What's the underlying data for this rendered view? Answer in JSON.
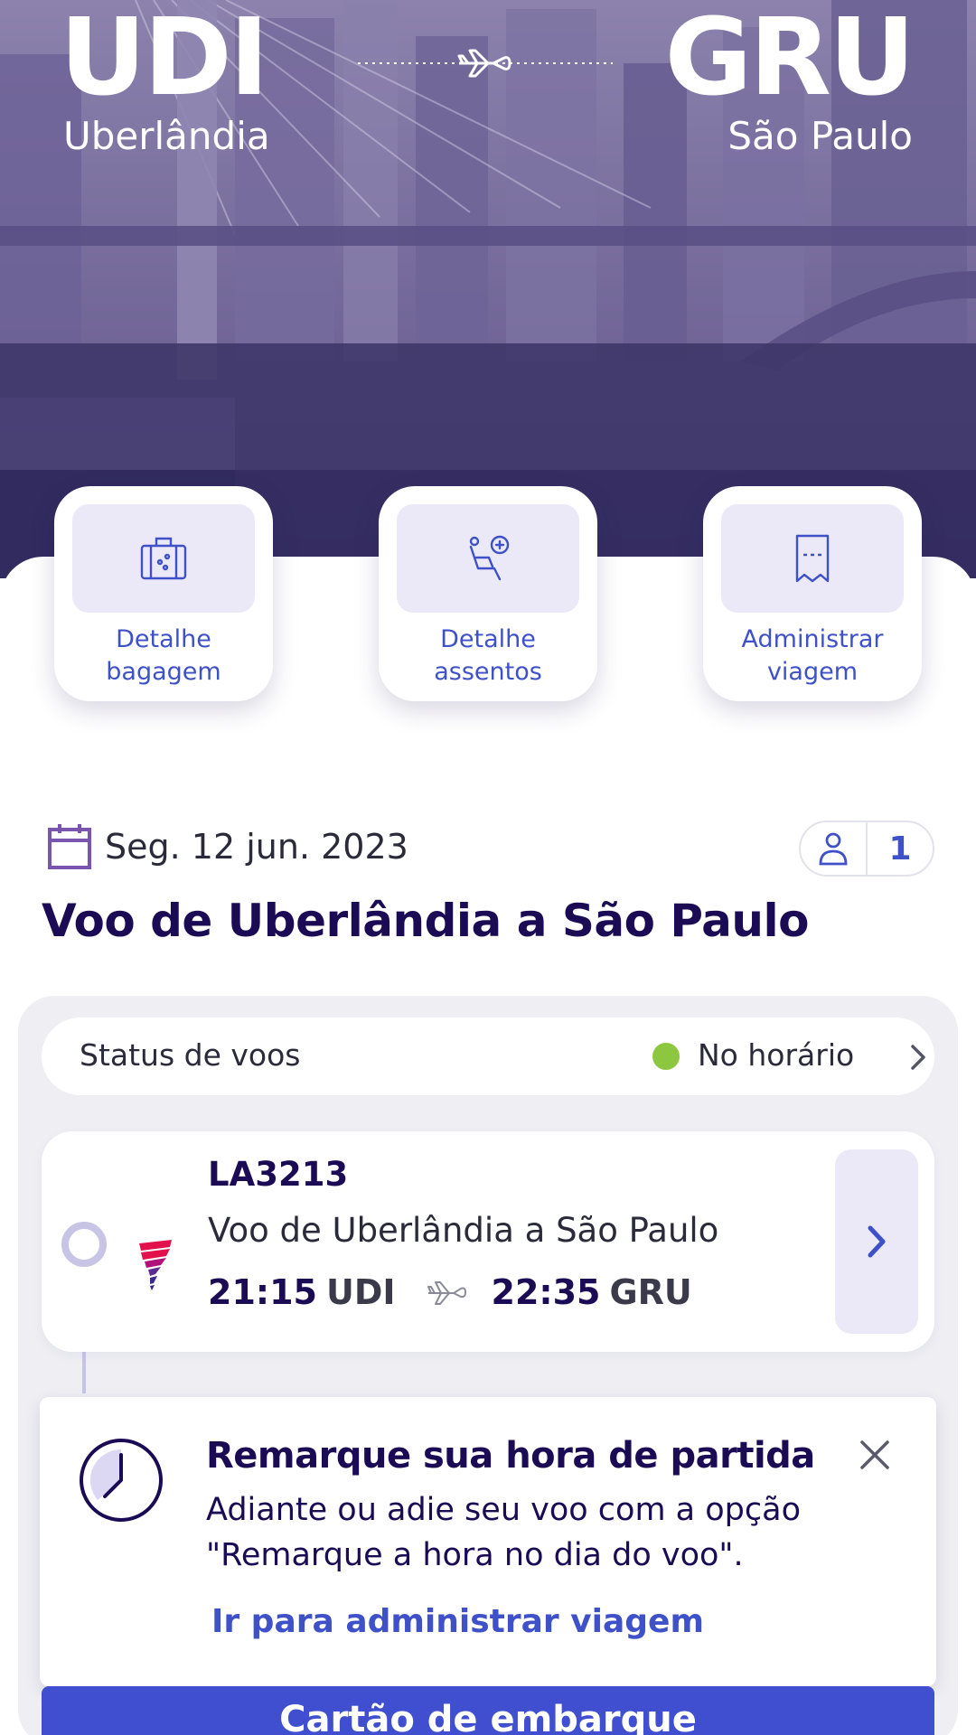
{
  "route": {
    "origin_code": "UDI",
    "origin_city": "Uberlândia",
    "destination_code": "GRU",
    "destination_city": "São Paulo"
  },
  "quick_actions": [
    {
      "label": "Detalhe\nbagagem",
      "icon": "baggage-icon"
    },
    {
      "label": "Detalhe\nassentos",
      "icon": "seat-icon"
    },
    {
      "label": "Administrar\nviagem",
      "icon": "manage-trip-icon"
    }
  ],
  "trip": {
    "date": "Seg. 12 jun. 2023",
    "passengers": "1",
    "title": "Voo de Uberlândia a São Paulo"
  },
  "status": {
    "label": "Status de voos",
    "value": "No horário",
    "color": "#8dc63f"
  },
  "flight": {
    "number": "LA3213",
    "description": "Voo de Uberlândia a São Paulo",
    "departure_time": "21:15",
    "departure_code": "UDI",
    "arrival_time": "22:35",
    "arrival_code": "GRU"
  },
  "promo": {
    "title": "Remarque sua hora de partida",
    "body": "Adiante ou adie seu voo com a opção\n\"Remarque a hora no dia do voo\".",
    "link": "Ir para administrar viagem"
  },
  "boarding_button": "Cartão de embarque",
  "colors": {
    "accent": "#3f51c8",
    "navy": "#1b0b54",
    "tile": "#ebe8f8",
    "status_on_time": "#8dc63f"
  }
}
